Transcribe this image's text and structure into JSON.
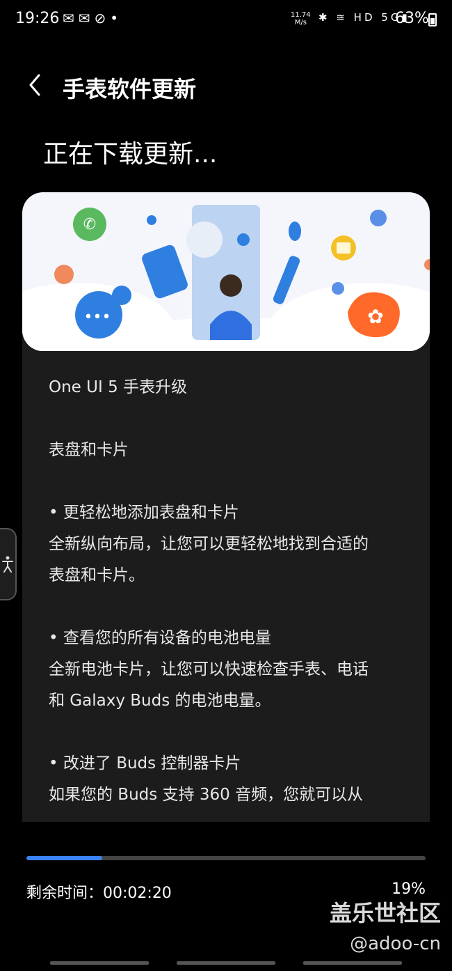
{
  "status": {
    "time": "19:26",
    "left_icons": "✉✉⊘•",
    "speed_top": "11.74",
    "speed_bottom": "M/s",
    "right_icons": "✱ ≋ HD 5G▮",
    "battery": "63%"
  },
  "header": {
    "title": "手表软件更新",
    "headline": "正在下载更新..."
  },
  "notes": {
    "title": "One UI 5 手表升级",
    "section": "表盘和卡片",
    "item1_title": "• 更轻松地添加表盘和卡片",
    "item1_line1": "全新纵向布局，让您可以更轻松地找到合适的",
    "item1_line2": "表盘和卡片。",
    "item2_title": "• 查看您的所有设备的电池电量",
    "item2_line1": "全新电池卡片，让您可以快速检查手表、电话",
    "item2_line2": "和 Galaxy Buds 的电池电量。",
    "item3_title": "• 改进了 Buds 控制器卡片",
    "item3_line1": "如果您的 Buds 支持 360 音频，您就可以从"
  },
  "progress": {
    "percent_value": 19,
    "remaining": "剩余时间：00:02:20",
    "percent_label": "19%"
  },
  "watermark": {
    "name": "盖乐世社区",
    "handle": "@adoo-cn"
  },
  "colors": {
    "accent": "#3b82f6",
    "background": "#000000",
    "card": "#1c1c1c"
  }
}
